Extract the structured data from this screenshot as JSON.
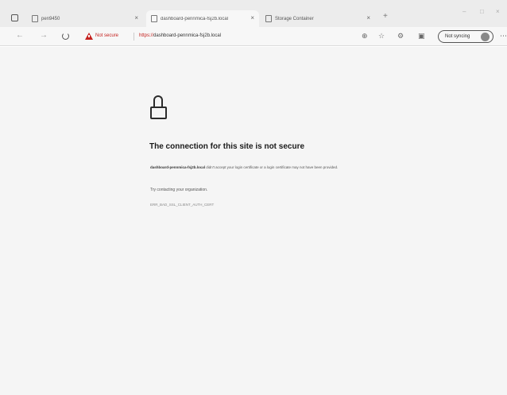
{
  "tabs": [
    {
      "title": "pen9450",
      "active": false
    },
    {
      "title": "dashboard-pennmica-fsj2b.local",
      "active": true
    },
    {
      "title": "Storage Container",
      "active": false
    }
  ],
  "toolbar": {
    "security_label": "Not secure",
    "url_scheme": "https://",
    "url_host": "dashboard-pennmica-fsj2b.local",
    "sync_label": "Not syncing"
  },
  "page": {
    "heading": "The connection for this site is not secure",
    "description_host": "dashboard-pennmica-fsj2b.local",
    "description_text": "didn't accept your login certificate or a login certificate may not have been provided.",
    "contact_text": "Try contacting your organization.",
    "error_code": "ERR_BAD_SSL_CLIENT_AUTH_CERT"
  },
  "colors": {
    "warning": "#c5221f",
    "page_bg": "#f5f5f5",
    "tabstrip_bg": "#ececec"
  }
}
